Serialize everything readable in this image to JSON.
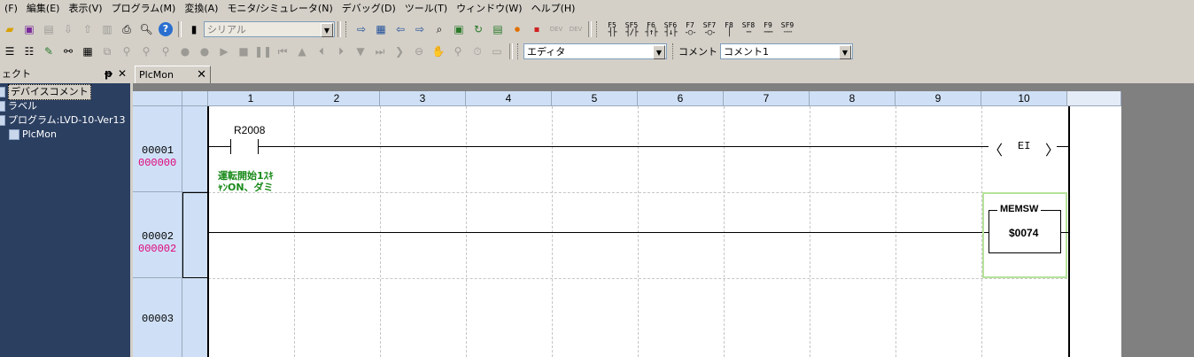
{
  "menubar": {
    "items": [
      "(F)",
      "編集(E)",
      "表示(V)",
      "プログラム(M)",
      "変換(A)",
      "モニタ/シミュレータ(N)",
      "デバッグ(D)",
      "ツール(T)",
      "ウィンドウ(W)",
      "ヘルプ(H)"
    ]
  },
  "toolbar1": {
    "port_combo": "シリアル",
    "fkeys": [
      {
        "label": "F5",
        "sym": "┤├"
      },
      {
        "label": "SF5",
        "sym": "┤/├"
      },
      {
        "label": "F6",
        "sym": "┤↑├"
      },
      {
        "label": "SF6",
        "sym": "┤↓├"
      },
      {
        "label": "F7",
        "sym": "-○-"
      },
      {
        "label": "SF7",
        "sym": "-◯-"
      },
      {
        "label": "F8",
        "sym": "│"
      },
      {
        "label": "SF8",
        "sym": "─"
      },
      {
        "label": "F9",
        "sym": "──"
      },
      {
        "label": "SF9",
        "sym": "┄┄"
      }
    ]
  },
  "toolbar2": {
    "mode_combo": "エディタ",
    "comment_label": "コメント",
    "comment_combo": "コメント1"
  },
  "left_panel": {
    "title": "ェクト",
    "pin": "ᵽ",
    "close": "✕",
    "tree": [
      {
        "label": "デバイスコメント",
        "selected": true
      },
      {
        "label": "ラベル",
        "selected": false
      },
      {
        "label": "プログラム:LVD-10-Ver13",
        "selected": false
      },
      {
        "label": "PlcMon",
        "selected": false
      }
    ]
  },
  "document": {
    "tab_label": "PlcMon",
    "tab_close": "✕",
    "columns": [
      "1",
      "2",
      "3",
      "4",
      "5",
      "6",
      "7",
      "8",
      "9",
      "10"
    ],
    "rows": [
      {
        "step": "00001",
        "address": "000000"
      },
      {
        "step": "00002",
        "address": "000002"
      },
      {
        "step": "00003",
        "address": ""
      }
    ],
    "rung1": {
      "contact_device": "R2008",
      "comment_line1": "運転開始1ｽｷ",
      "comment_line2": "ｬﾝON、ダミ",
      "coil_open": "〈",
      "coil_text": "EI",
      "coil_close": "〉"
    },
    "rung2": {
      "fb_title": "MEMSW",
      "fb_value": "$0074"
    }
  }
}
